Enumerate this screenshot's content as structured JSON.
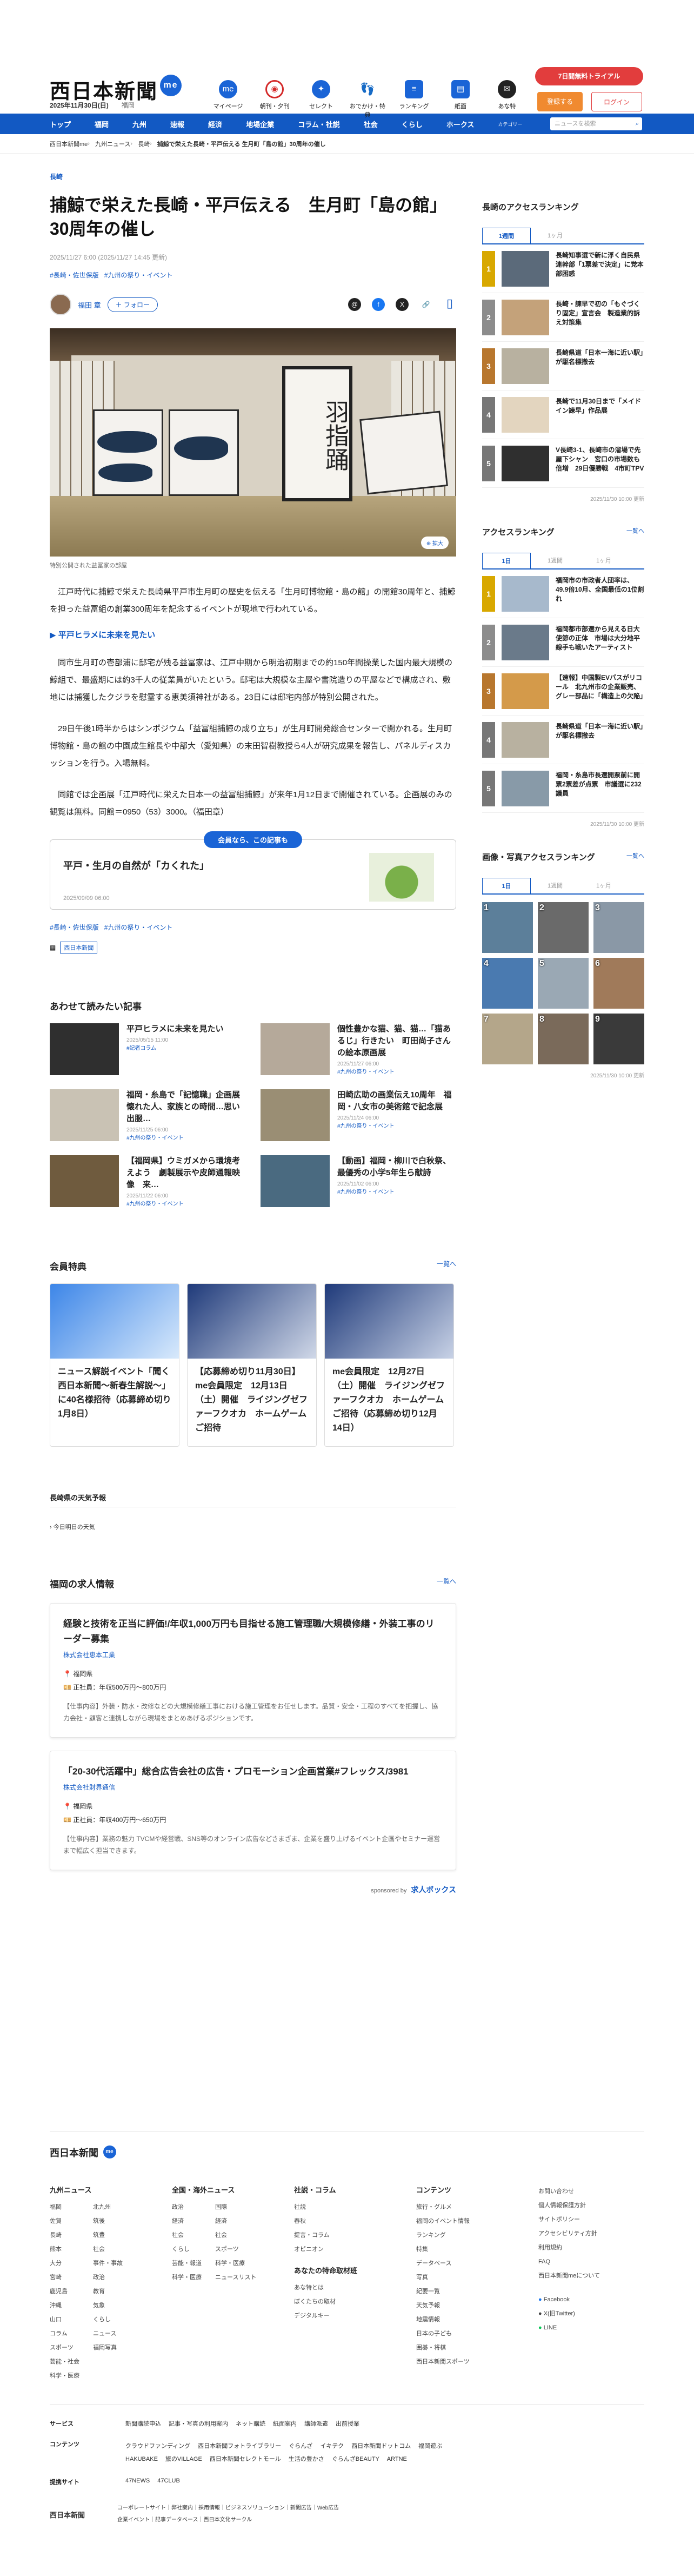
{
  "header": {
    "logo": "西日本新聞",
    "logo_me": "me",
    "date": "2025年11月30日(日)",
    "region": "福岡",
    "icons": [
      {
        "label": "マイページ",
        "icon": "me-icon"
      },
      {
        "label": "朝刊・夕刊",
        "icon": "paper-icon"
      },
      {
        "label": "セレクト",
        "icon": "select-icon"
      },
      {
        "label": "おでかけ・特典",
        "icon": "ticket-icon"
      },
      {
        "label": "ランキング",
        "icon": "ranking-icon"
      },
      {
        "label": "紙面",
        "icon": "page-icon"
      },
      {
        "label": "あな特",
        "icon": "chat-icon"
      }
    ],
    "trial": "7日間無料トライアル",
    "register": "登録する",
    "login": "ログイン"
  },
  "nav": {
    "items": [
      "トップ",
      "福岡",
      "九州",
      "速報",
      "経済",
      "地場企業",
      "コラム・社説",
      "社会",
      "くらし",
      "ホークス"
    ],
    "category_label": "カテゴリー",
    "search_placeholder": "ニュースを検索"
  },
  "breadcrumb": [
    "西日本新聞me",
    "九州ニュース",
    "長崎",
    "捕鯨で栄えた長崎・平戸伝える 生月町「島の館」30周年の催し"
  ],
  "article": {
    "category": "長崎",
    "title": "捕鯨で栄えた長崎・平戸伝える　生月町「島の館」30周年の催し",
    "timestamp": "2025/11/27 6:00 (2025/11/27 14:45 更新)",
    "tags": [
      "#長崎・佐世保版",
      "#九州の祭り・イベント"
    ],
    "author": "福田 章",
    "follow": "フォロー",
    "photo_calligraphy": "羽指踊",
    "zoom": "拡大",
    "caption": "特別公開された益冨家の部屋",
    "paragraphs": [
      "江戸時代に捕鯨で栄えた長崎県平戸市生月町の歴史を伝える「生月町博物館・島の館」の開館30周年と、捕鯨を担った益冨組の創業300周年を記念するイベントが現地で行われている。",
      "同市生月町の壱部浦に邸宅が残る益冨家は、江戸中期から明治初期までの約150年間操業した国内最大規模の鯨組で、最盛期には約3千人の従業員がいたという。邸宅は大規模な主屋や書院造りの平屋などで構成され、敷地には捕獲したクジラを慰霊する恵美須神社がある。23日には邸宅内部が特別公開された。",
      "29日午後1時半からはシンポジウム「益冨組捕鯨の成り立ち」が生月町開発総合センターで開かれる。生月町博物館・島の館の中園成生館長や中部大（愛知県）の末田智樹教授ら4人が研究成果を報告し、パネルディスカッションを行う。入場無料。",
      "同館では企画展「江戸時代に栄えた日本一の益冨組捕鯨」が来年1月12日まで開催されている。企画展のみの観覧は無料。同館＝0950（53）3000。（福田章）"
    ],
    "link": "平戸ヒラメに未来を見たい",
    "member_badge": "会員なら、この記事も",
    "member_title": "平戸・生月の自然が「カくれた」",
    "member_date": "2025/09/09 06:00",
    "tags_bottom": [
      "#長崎・佐世保版",
      "#九州の祭り・イベント"
    ],
    "publisher": "西日本新聞"
  },
  "related": {
    "heading": "あわせて読みたい記事",
    "items": [
      {
        "title": "平戸ヒラメに未来を見たい",
        "meta": "2025/05/15 11:00",
        "tag": "#記者コラム"
      },
      {
        "title": "個性豊かな猫、猫、猫…「猫あるじ」行きたい　町田尚子さんの絵本原画展",
        "meta": "2025/11/27 06:00",
        "tag": "#九州の祭り・イベント"
      },
      {
        "title": "福岡・糸島で「記憶職」企画展　懐れた人、家族との時間…思い出服…",
        "meta": "2025/11/25 06:00",
        "tag": "#九州の祭り・イベント"
      },
      {
        "title": "田崎広助の画業伝え10周年　福岡・八女市の美術館で記念展",
        "meta": "2025/11/24 06:00",
        "tag": "#九州の祭り・イベント"
      },
      {
        "title": "【福岡県】ウミガメから環境考えよう　劇製展示や皮師通報映像　来…",
        "meta": "2025/11/22 06:00",
        "tag": "#九州の祭り・イベント"
      },
      {
        "title": "【動画】福岡・柳川で白秋祭、最優秀の小学5年生ら献詩",
        "meta": "2025/11/02 06:00",
        "tag": "#九州の祭り・イベント"
      }
    ]
  },
  "benefits": {
    "heading": "会員特典",
    "more": "一覧へ",
    "items": [
      {
        "title": "ニュース解説イベント「聞く西日本新聞〜新春生解説〜」に40名様招待（応募締め切り1月8日）"
      },
      {
        "title": "【応募締め切り11月30日】me会員限定　12月13日（土）開催　ライジングゼファーフクオカ　ホームゲームご招待"
      },
      {
        "title": "me会員限定　12月27日（土）開催　ライジングゼファーフクオカ　ホームゲームご招待（応募締め切り12月14日）"
      }
    ]
  },
  "weather": {
    "heading": "長崎県の天気予報",
    "today": "今日明日の天気"
  },
  "jobs": {
    "heading": "福岡の求人情報",
    "more": "一覧へ",
    "items": [
      {
        "title": "経験と技術を正当に評価!/年収1,000万円も目指せる施工管理職/大規模修繕・外装工事のリーダー募集",
        "company": "株式会社恵本工業",
        "location": "福岡県",
        "salary": "正社員：年収500万円〜800万円",
        "desc": "【仕事内容】外装・防水・改修などの大規模修繕工事における施工管理をお任せします。品質・安全・工程のすべてを把握し、協力会社・顧客と連携しながら現場をまとめあげるポジションです。"
      },
      {
        "title": "「20-30代活躍中」総合広告会社の広告・プロモーション企画営業#フレックス/3981",
        "company": "株式会社財界通信",
        "location": "福岡県",
        "salary": "正社員：年収400万円〜650万円",
        "desc": "【仕事内容】業務の魅力 TVCMや経営戦、SNS等のオンライン広告などさまざま、企業を盛り上げるイベント企画やセミナー運営まで幅広く担当できます。"
      }
    ],
    "sponsor": "sponsored by",
    "sponsor_name": "求人ボックス"
  },
  "sidebar": {
    "ranking_nagasaki": {
      "heading": "長崎のアクセスランキング",
      "tabs": [
        "1週間",
        "1ヶ月"
      ],
      "items": [
        "長崎知事選で新に浮く自民県連幹部「1票差で決定」に党本部困惑",
        "長崎・諫早で初の「もぐづくり固定」宣言会　製造業的訴え対策集",
        "長崎県道「日本一海に近い駅」が駆名標撤去",
        "長崎で11月30日まで「メイドイン諫早」作品展",
        "V長崎3-1、長崎市の溜場で先屋下シャン　宮口の市場数も倍増　29日優勝戦　4市町TPV"
      ],
      "updated": "2025/11/30 10:00 更新"
    },
    "ranking_all": {
      "heading": "アクセスランキング",
      "more": "一覧へ",
      "tabs": [
        "1日",
        "1週間",
        "1ヶ月"
      ],
      "items": [
        "福岡市の市政者人団率は、49.9倍10月、全国最低の1位割れ",
        "福岡都市部選から見える日大使節の正体　市場は大分地平線手も戦いたアーティスト",
        "【速報】中国製EVバスがリコール　北九州市の企業販売、グレー部品に「構造上の欠陥」",
        "長崎県道「日本一海に近い駅」が駆名標撤去",
        "福岡・糸島市長選開票前に開票2票差が点票　市議選に232議員"
      ],
      "updated": "2025/11/30 10:00 更新"
    },
    "photos": {
      "heading": "画像・写真アクセスランキング",
      "more": "一覧へ",
      "tabs": [
        "1日",
        "1週間",
        "1ヶ月"
      ],
      "items": [
        "1",
        "2",
        "3",
        "4",
        "5",
        "6",
        "7",
        "8",
        "9"
      ],
      "updated": "2025/11/30 10:00 更新"
    }
  },
  "footer": {
    "logo": "西日本新聞",
    "logo_me": "me",
    "columns": [
      {
        "title": "九州ニュース",
        "items": [
          "福岡",
          "佐賀",
          "長崎",
          "熊本",
          "大分",
          "宮崎",
          "鹿児島",
          "沖縄",
          "山口",
          "コラム",
          "スポーツ",
          "芸能・社会",
          "科学・医療"
        ],
        "items2": [
          "北九州",
          "筑後",
          "筑豊",
          "社会",
          "事件・事故",
          "政治",
          "教育",
          "気象",
          "くらし",
          "ニュース",
          "福岡写真"
        ]
      },
      {
        "title": "全国・海外ニュース",
        "items": [
          "政治",
          "経済",
          "社会",
          "くらし",
          "芸能・報道",
          "科学・医療"
        ],
        "items2": [
          "国際",
          "経済",
          "社会",
          "スポーツ",
          "科学・医療",
          "ニュースリスト"
        ]
      },
      {
        "title": "社説・コラム",
        "items": [
          "社説",
          "春秋",
          "提言・コラム",
          "オピニオン"
        ],
        "title2": "あなたの特命取材班",
        "items3": [
          "あな特とは",
          "ぼくたちの取材",
          "デジタルキー"
        ]
      },
      {
        "title": "コンテンツ",
        "items": [
          "旅行・グルメ",
          "福岡のイベント情報",
          "ランキング",
          "特集",
          "データベース",
          "写真",
          "紀要一覧",
          "天気予報",
          "地震情報",
          "日本の子ども",
          "囲碁・将棋",
          "西日本新聞スポーツ"
        ]
      },
      {
        "title": "",
        "items": [
          "お問い合わせ",
          "個人情報保護方針",
          "サイトポリシー",
          "アクセシビリティ方針",
          "利用規約",
          "FAQ",
          "西日本新聞meについて"
        ],
        "social": [
          "Facebook",
          "X(旧Twitter)",
          "LINE"
        ]
      }
    ],
    "rows": [
      {
        "label": "サービス",
        "items": [
          "新聞購読申込",
          "記事・写真の利用案内",
          "ネット購読",
          "紙面案内",
          "講師派遣",
          "出前授業"
        ]
      },
      {
        "label": "コンテンツ",
        "items": [
          "クラウドファンディング",
          "西日本新聞フォトライブラリー",
          "ぐらんざ",
          "イキテク",
          "西日本新聞ドットコム",
          "福岡遊ぶ",
          "HAKUBAKE",
          "旅のVILLAGE",
          "西日本新聞セレクトモール",
          "生活の豊かさ",
          "ぐらんざBEAUTY",
          "ARTNE"
        ]
      },
      {
        "label": "提携サイト",
        "items": [
          "47NEWS",
          "47CLUB"
        ]
      }
    ],
    "copy_logo": "西日本新聞",
    "copy_links": [
      "コーポレートサイト",
      "弊社案内",
      "採用情報",
      "ビジネスソリューション",
      "新聞広告",
      "Web広告",
      "企業イベント",
      "記事データベース",
      "西日本文化サークル"
    ]
  }
}
